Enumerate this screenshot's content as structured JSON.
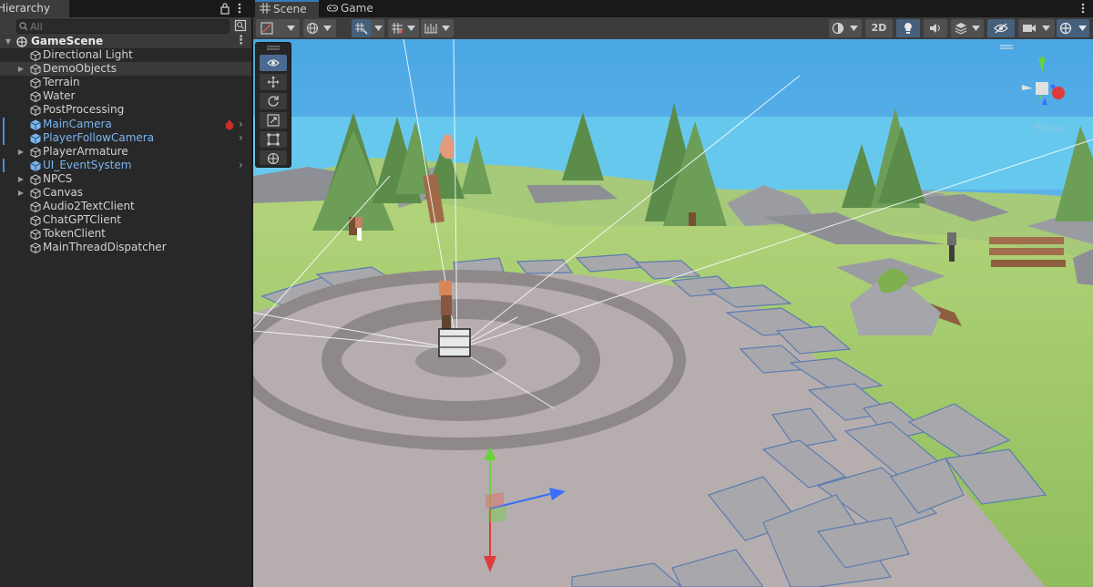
{
  "hierarchy": {
    "tab_label": "Hierarchy",
    "search_placeholder": "All",
    "scene": {
      "name": "GameScene"
    },
    "items": [
      {
        "label": "Directional Light",
        "prefab": false,
        "has_children": false
      },
      {
        "label": "DemoObjects",
        "prefab": false,
        "has_children": true,
        "highlighted": true
      },
      {
        "label": "Terrain",
        "prefab": false,
        "has_children": false
      },
      {
        "label": "Water",
        "prefab": false,
        "has_children": false
      },
      {
        "label": "PostProcessing",
        "prefab": false,
        "has_children": false
      },
      {
        "label": "MainCamera",
        "prefab": true,
        "has_children": false,
        "warning": true,
        "expand_arrow": true
      },
      {
        "label": "PlayerFollowCamera",
        "prefab": true,
        "has_children": false,
        "expand_arrow": true
      },
      {
        "label": "PlayerArmature",
        "prefab": false,
        "has_children": true
      },
      {
        "label": "UI_EventSystem",
        "prefab": true,
        "has_children": false,
        "expand_arrow": true
      },
      {
        "label": "NPCS",
        "prefab": false,
        "has_children": true
      },
      {
        "label": "Canvas",
        "prefab": false,
        "has_children": true
      },
      {
        "label": "Audio2TextClient",
        "prefab": false,
        "has_children": false
      },
      {
        "label": "ChatGPTClient",
        "prefab": false,
        "has_children": false
      },
      {
        "label": "TokenClient",
        "prefab": false,
        "has_children": false
      },
      {
        "label": "MainThreadDispatcher",
        "prefab": false,
        "has_children": false
      }
    ]
  },
  "scene_view": {
    "tabs": [
      {
        "label": "Scene",
        "icon": "grid-icon",
        "active": true
      },
      {
        "label": "Game",
        "icon": "gamepad-icon",
        "active": false
      }
    ],
    "toolbar": {
      "left": [
        "draw-mode-button",
        "global-orientation-button",
        "snap-toggle-button",
        "grid-snap-button",
        "increment-snap-button"
      ],
      "right": [
        "shading-mode-button",
        "2d-toggle",
        "lighting-toggle",
        "audio-toggle",
        "effects-toggle",
        "visibility-toggle",
        "camera-settings-button",
        "gizmos-button"
      ],
      "toggle_2d_label": "2D"
    },
    "tools": [
      "view-tool",
      "move-tool",
      "rotate-tool",
      "scale-tool",
      "rect-tool",
      "transform-tool"
    ],
    "orientation_gizmo_label": "Persp"
  },
  "colors": {
    "accent": "#3a79bb",
    "prefab_text": "#7db4ee",
    "panel_bg": "#282828",
    "sky": "#4fb0e8",
    "water": "#6fd0f0",
    "grass": "#9cc46a",
    "plaza": "#b9b0b0"
  }
}
